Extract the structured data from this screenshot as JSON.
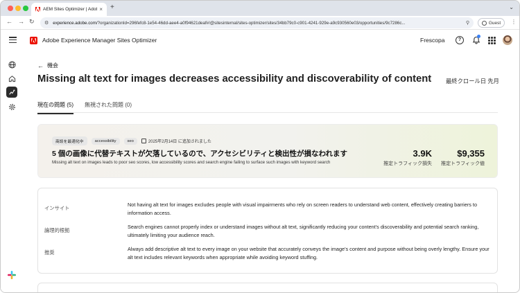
{
  "browser": {
    "tab_title": "AEM Sites Optimizer | Adobe",
    "url_prefix": "experience.adobe.com",
    "url_rest": "/?organizationId=296fefc8-1e54-46dd-aee4-a0f94621deaf#/@sitesinternal/sites-optimizer/sites/34bb79c0-c901-4241-929e-a9c930560e03/opportunities/9c7286c...",
    "guest_label": "Guest"
  },
  "app": {
    "title": "Adobe Experience Manager Sites Optimizer",
    "org_name": "Frescopa"
  },
  "page": {
    "back_label": "機会",
    "title": "Missing alt text for images decreases accessibility and discoverability of content",
    "last_crawl": "最終クロール日 先月",
    "tabs": [
      {
        "label": "現在の問題 (5)",
        "active": true
      },
      {
        "label": "無視された問題 (0)",
        "active": false
      }
    ]
  },
  "summary": {
    "tags": [
      "商談を最適化中",
      "accessibility",
      "seo"
    ],
    "added_date": "2025年2月14日 に追加されました",
    "headline": "5 個の画像に代替テキストが欠落しているので、アクセシビリティと検出性が損なわれます",
    "description": "Missing alt text on images leads to poor seo scores, low accessibility scores and search engine failing to surface such images with keyword search",
    "metrics": [
      {
        "value": "3.9K",
        "label": "推定トラフィック損失"
      },
      {
        "value": "$9,355",
        "label": "推定トラフィック値"
      }
    ]
  },
  "details": [
    {
      "label": "インサイト",
      "text": "Not having alt text for images excludes people with visual impairments who rely on screen readers to understand web content, effectively creating barriers to information access."
    },
    {
      "label": "論理的根拠",
      "text": "Search engines cannot properly index or understand images without alt text, significantly reducing your content's discoverability and potential search ranking, ultimately limiting your audience reach."
    },
    {
      "label": "推奨",
      "text": "Always add descriptive alt text to every image on your website that accurately conveys the image's content and purpose without being overly lengthy. Ensure your alt text includes relevant keywords when appropriate while avoiding keyword stuffing."
    }
  ],
  "colors": {
    "adobe_red": "#eb1000",
    "rail_active": "#2b2b2b",
    "notification_dot": "#3b82f6"
  }
}
